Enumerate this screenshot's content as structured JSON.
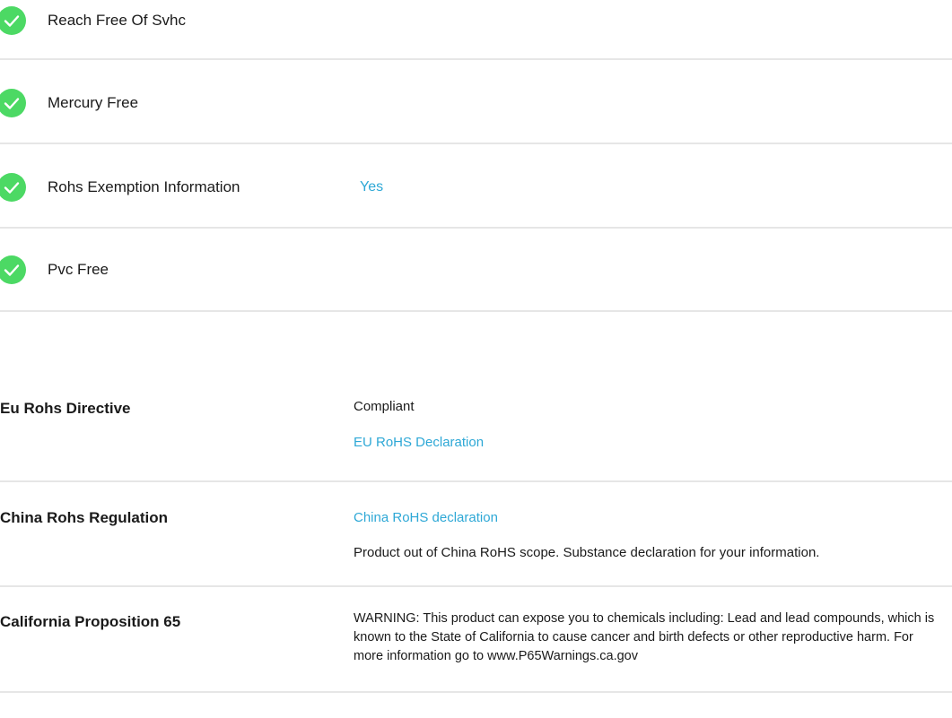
{
  "checklist": [
    {
      "label": "Reach Free Of Svhc",
      "value": "",
      "icon": "check-circle-icon"
    },
    {
      "label": "Mercury Free",
      "value": "",
      "icon": "check-circle-icon"
    },
    {
      "label": "Rohs Exemption Information",
      "value": "Yes",
      "icon": "check-circle-icon"
    },
    {
      "label": "Pvc Free",
      "value": "",
      "icon": "check-circle-icon"
    }
  ],
  "compliance": {
    "eu": {
      "label": "Eu Rohs Directive",
      "status": "Compliant",
      "link": "EU RoHS Declaration"
    },
    "china": {
      "label": "China Rohs Regulation",
      "link": "China RoHS declaration",
      "note": "Product out of China RoHS scope. Substance declaration for your information."
    },
    "california": {
      "label": "California Proposition 65",
      "warning": "WARNING: This product can expose you to chemicals including: Lead and lead compounds, which is known to the State of California to cause cancer and birth defects or other reproductive harm. For more information go to www.P65Warnings.ca.gov"
    }
  },
  "colors": {
    "check_green": "#4cd964",
    "link_blue": "#2ea8d6",
    "divider": "#e6e6e6"
  }
}
